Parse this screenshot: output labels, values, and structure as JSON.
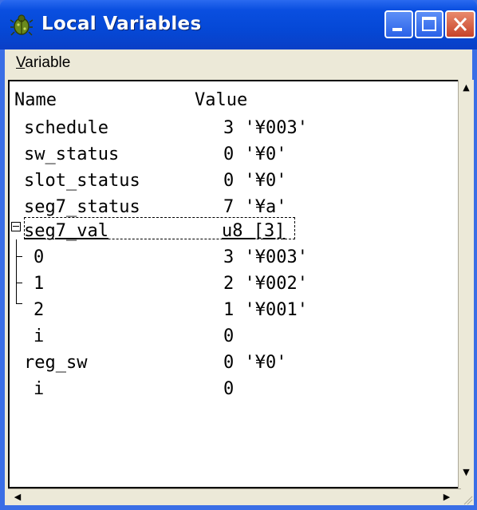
{
  "window": {
    "title": "Local Variables",
    "icon": "bug-icon",
    "accent": "#0548d6",
    "close_color": "#c7432a"
  },
  "menu": {
    "variable_first": "V",
    "variable_rest": "ariable"
  },
  "columns": {
    "name": "Name",
    "value": "Value"
  },
  "rows": [
    {
      "name": "schedule",
      "value": "3 '¥003'"
    },
    {
      "name": "sw_status",
      "value": "0 '¥0'"
    },
    {
      "name": "slot_status",
      "value": "0 '¥0'"
    },
    {
      "name": "seg7_status",
      "value": "7 '¥a'"
    },
    {
      "name": "seg7_val",
      "value": "u8 [3]"
    },
    {
      "name": "0",
      "value": "3 '¥003'"
    },
    {
      "name": "1",
      "value": "2 '¥002'"
    },
    {
      "name": "2",
      "value": "1 '¥001'"
    },
    {
      "name": "i",
      "value": "0"
    },
    {
      "name": "reg_sw",
      "value": "0 '¥0'"
    },
    {
      "name": "i",
      "value": "0"
    }
  ]
}
